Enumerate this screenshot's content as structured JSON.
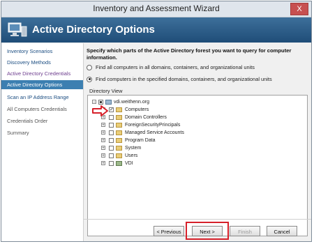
{
  "window": {
    "title": "Inventory and Assessment Wizard",
    "close_label": "X"
  },
  "header": {
    "title": "Active Directory Options",
    "icon": "wizard-computer-icon"
  },
  "sidebar": {
    "items": [
      {
        "label": "Inventory Scenarios",
        "state": "visited"
      },
      {
        "label": "Discovery Methods",
        "state": "visited"
      },
      {
        "label": "Active Directory Credentials",
        "state": "done"
      },
      {
        "label": "Active Directory Options",
        "state": "active"
      },
      {
        "label": "Scan an IP Address Range",
        "state": "visited"
      },
      {
        "label": "All Computers Credentials",
        "state": "pending"
      },
      {
        "label": "Credentials Order",
        "state": "pending"
      },
      {
        "label": "Summary",
        "state": "pending"
      }
    ]
  },
  "main": {
    "instruction": "Specify which parts of the Active Directory forest you want to query for computer information.",
    "options": [
      {
        "label": "Find all computers in all domains, containers, and organizational units",
        "selected": false
      },
      {
        "label": "Find computers in the specified domains, containers, and organizational units",
        "selected": true
      }
    ],
    "directory_view_label": "Directory View",
    "tree": {
      "root": "vdi.weithenn.org",
      "children": [
        {
          "label": "Computers",
          "checked": true
        },
        {
          "label": "Domain Controllers",
          "checked": false
        },
        {
          "label": "ForeignSecurityPrincipals",
          "checked": false
        },
        {
          "label": "Managed Service Accounts",
          "checked": false
        },
        {
          "label": "Program Data",
          "checked": false
        },
        {
          "label": "System",
          "checked": false
        },
        {
          "label": "Users",
          "checked": false
        },
        {
          "label": "VDI",
          "checked": false
        }
      ]
    }
  },
  "footer": {
    "previous_label": "< Previous",
    "next_label": "Next >",
    "finish_label": "Finish",
    "cancel_label": "Cancel"
  },
  "colors": {
    "header_bg": "#1f4d78",
    "active_nav": "#3c7fb1",
    "highlight": "#d6202a",
    "arrow": "#d6202a"
  }
}
